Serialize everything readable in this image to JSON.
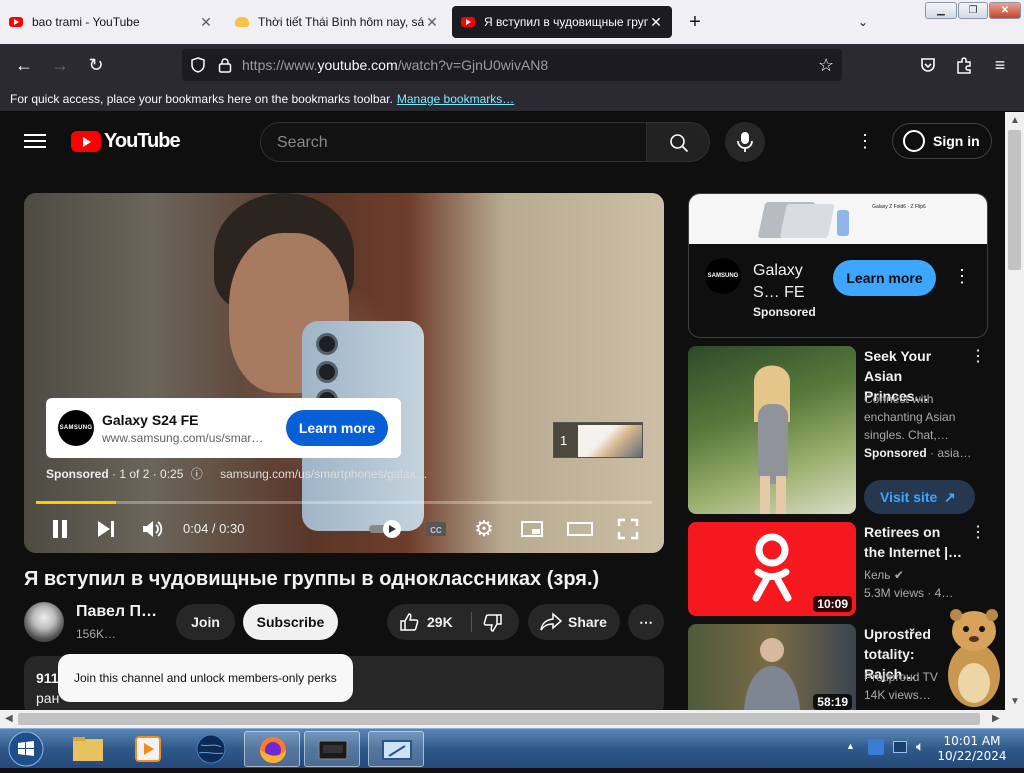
{
  "browser": {
    "tabs": [
      {
        "title": "bao trami - YouTube",
        "active": false
      },
      {
        "title": "Thời tiết Thái Bình hôm nay, sáng",
        "active": false
      },
      {
        "title": "Я вступил в чудовищные групп",
        "active": true
      }
    ],
    "new_tab_icon": "plus-icon",
    "list_tabs_icon": "chevron-down-icon",
    "url_prefix": "https://www.",
    "url_host": "youtube.com",
    "url_rest": "/watch?v=GjnU0wivAN8",
    "bookmark_msg": "For quick access, place your bookmarks here on the bookmarks toolbar.",
    "bookmark_link": "Manage bookmarks…"
  },
  "header": {
    "logo_text": "YouTube",
    "search_placeholder": "Search",
    "signin_label": "Sign in"
  },
  "player": {
    "ad": {
      "brand_logo": "SAMSUNG",
      "title": "Galaxy S24 FE",
      "url": "www.samsung.com/us/smar…",
      "cta": "Learn more"
    },
    "ad_info": {
      "sponsored": "Sponsored",
      "count": "· 1 of 2 · 0:25",
      "link": "samsung.com/us/smartphones/galax…"
    },
    "skip_count": "1",
    "progress": 0.13,
    "progress_color": "#ffcc00",
    "time": "0:04 / 0:30"
  },
  "video": {
    "title": "Я вступил в чудовищные группы в одноклассниках (зря.)",
    "channel": "Павел П…",
    "subscribers": "156K…",
    "join_label": "Join",
    "subscribe_label": "Subscribe",
    "likes": "29K",
    "share_label": "Share",
    "tooltip": "Join this channel and unlock members-only perks",
    "desc_views": "911",
    "desc_line": "ран"
  },
  "sidebar": {
    "ad": {
      "banner_text": "Galaxy Z Fold6 · Z Flip6",
      "brand_logo": "SAMSUNG",
      "name": "Galaxy S… FE",
      "sponsored": "Sponsored",
      "cta": "Learn more"
    },
    "items": [
      {
        "title": "Seek Your Asian Princes…",
        "desc": "Connect with enchanting Asian singles. Chat,…",
        "sponsor": "Sponsored",
        "sponsor_site": "· asia…",
        "cta": "Visit site"
      },
      {
        "title": "Retirees on the Internet |…",
        "channel": "Кель",
        "views": "5.3M views · 4…",
        "duration": "10:09"
      },
      {
        "title": "Uprostřed totality: Rajch…",
        "channel": "Protiproud TV",
        "views": "14K views…",
        "duration": "58:19"
      }
    ]
  },
  "taskbar": {
    "time": "10:01 AM",
    "date": "10/22/2024"
  }
}
